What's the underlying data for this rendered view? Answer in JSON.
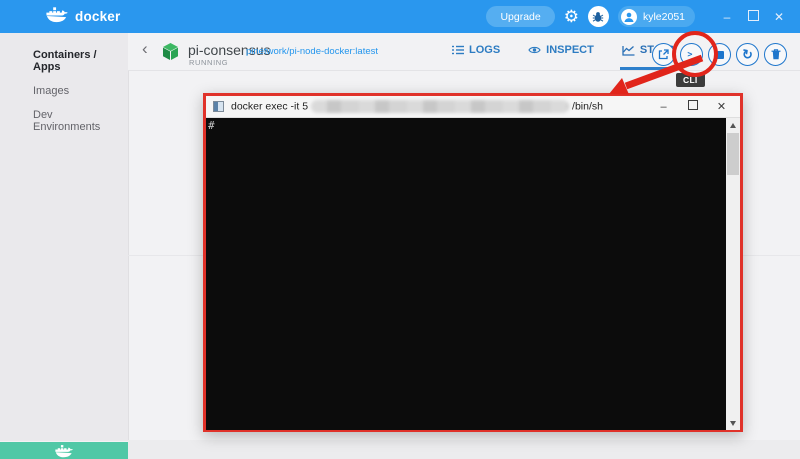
{
  "header": {
    "logo_text": "docker",
    "upgrade_button": "Upgrade",
    "username": "kyle2051",
    "window_controls": {
      "minimize": "–",
      "close": "✕"
    }
  },
  "sidebar": {
    "items": [
      {
        "label": "Containers / Apps",
        "active": true
      },
      {
        "label": "Images",
        "active": false
      },
      {
        "label": "Dev Environments",
        "active": false
      }
    ]
  },
  "container_header": {
    "back_glyph": "‹",
    "name": "pi-consensus",
    "image": "pinetwork/pi-node-docker:latest",
    "status": "RUNNING",
    "tabs": [
      {
        "label": "LOGS",
        "active": false
      },
      {
        "label": "INSPECT",
        "active": false
      },
      {
        "label": "STATS",
        "active": true
      }
    ],
    "actions": {
      "cli_glyph": ">_",
      "restart_glyph": "↻",
      "cli_tooltip": "CLI"
    }
  },
  "terminal_window": {
    "title_prefix": "docker exec -it 5",
    "title_suffix": "/bin/sh",
    "prompt": "#",
    "window_controls": {
      "minimize": "–",
      "close": "✕"
    }
  },
  "colors": {
    "header_blue": "#2a97ee",
    "accent_blue": "#1e76cc",
    "link_blue": "#2496ed",
    "running_teal": "#50c8a6",
    "annotation_red": "#e1251b",
    "container_green": "#2aa453",
    "terminal_black": "#0c0c0c"
  }
}
